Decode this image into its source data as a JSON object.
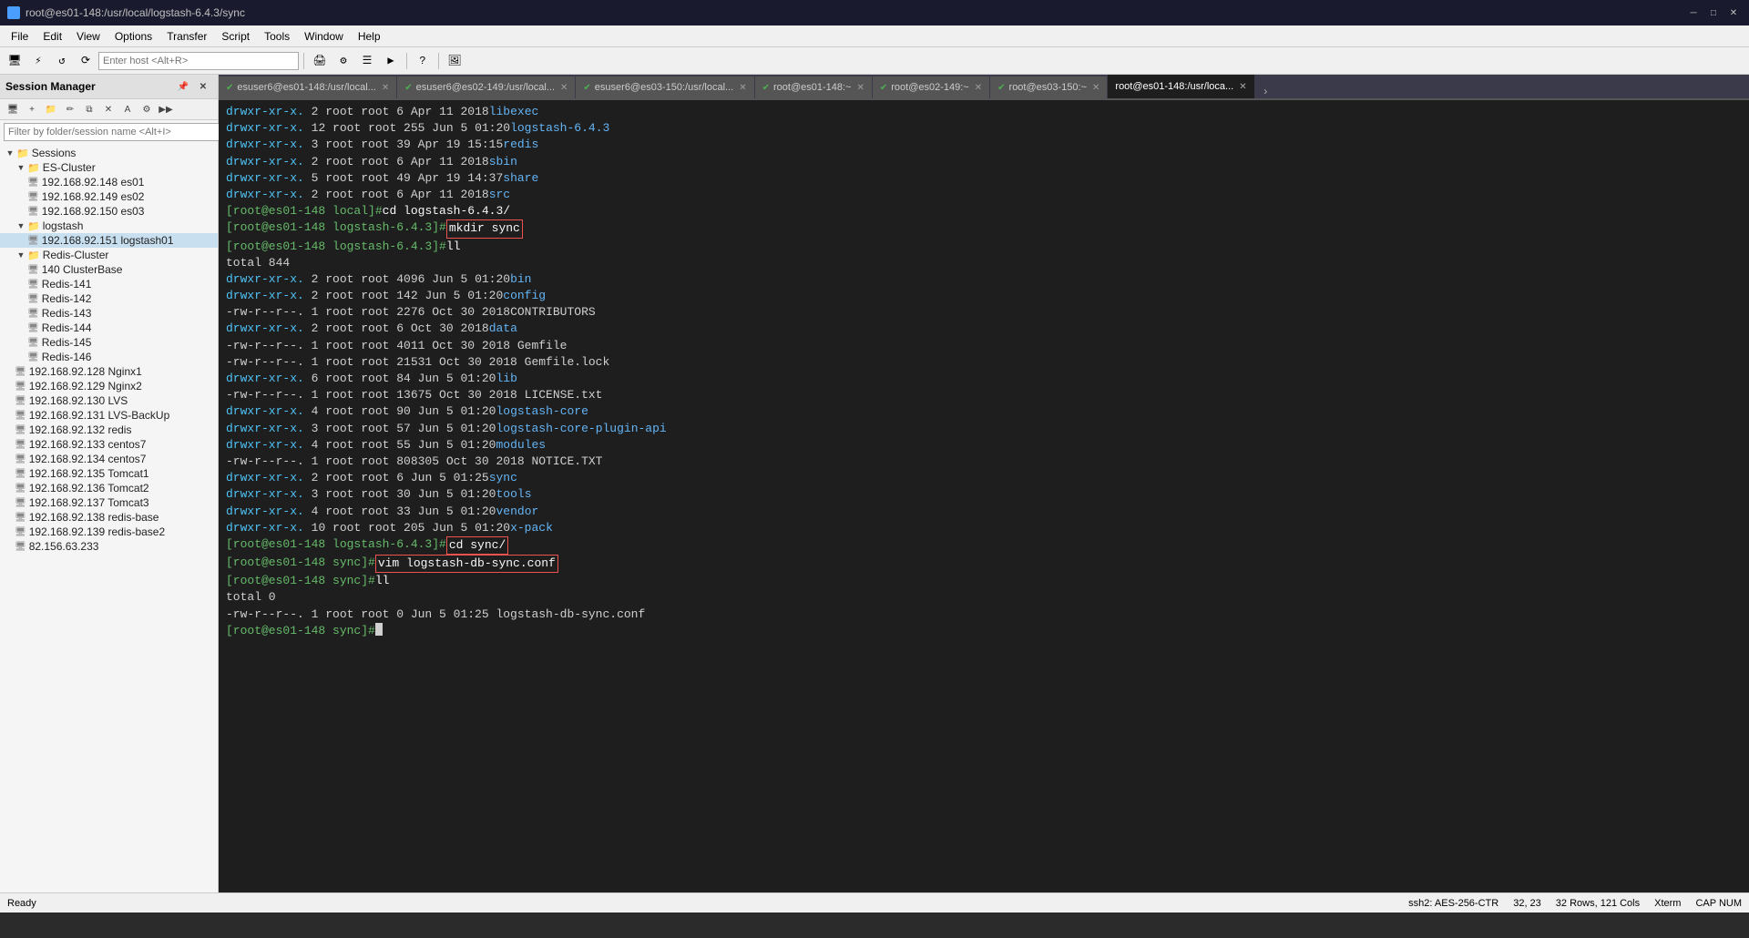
{
  "titlebar": {
    "title": "root@es01-148:/usr/local/logstash-6.4.3/sync",
    "min": "─",
    "max": "□",
    "close": "✕"
  },
  "menubar": {
    "items": [
      "File",
      "Edit",
      "View",
      "Options",
      "Transfer",
      "Script",
      "Tools",
      "Window",
      "Help"
    ]
  },
  "toolbar": {
    "host_placeholder": "Enter host <Alt+R>",
    "host_value": ""
  },
  "session_manager": {
    "title": "Session Manager",
    "filter_placeholder": "Filter by folder/session name <Alt+I>",
    "sessions_label": "Sessions",
    "groups": [
      {
        "name": "ES-Cluster",
        "expanded": true,
        "items": [
          "192.168.92.148 es01",
          "192.168.92.149 es02",
          "192.168.92.150 es03"
        ]
      },
      {
        "name": "logstash",
        "expanded": true,
        "items": [
          "192.168.92.151 logstash01"
        ]
      },
      {
        "name": "Redis-Cluster",
        "expanded": true,
        "items": [
          "140 ClusterBase",
          "Redis-141",
          "Redis-142",
          "Redis-143",
          "Redis-144",
          "Redis-145",
          "Redis-146"
        ]
      }
    ],
    "standalone": [
      "192.168.92.128 Nginx1",
      "192.168.92.129 Nginx2",
      "192.168.92.130 LVS",
      "192.168.92.131 LVS-BackUp",
      "192.168.92.132 redis",
      "192.168.92.133 centos7",
      "192.168.92.134 centos7",
      "192.168.92.135 Tomcat1",
      "192.168.92.136 Tomcat2",
      "192.168.92.137 Tomcat3",
      "192.168.92.138 redis-base",
      "192.168.92.139 redis-base2",
      "82.156.63.233"
    ]
  },
  "tabs": [
    {
      "label": "esuser6@es01-148:/usr/local...",
      "active": false,
      "check": true
    },
    {
      "label": "esuser6@es02-149:/usr/local...",
      "active": false,
      "check": true
    },
    {
      "label": "esuser6@es03-150:/usr/local...",
      "active": false,
      "check": true
    },
    {
      "label": "root@es01-148:~",
      "active": false,
      "check": true
    },
    {
      "label": "root@es02-149:~",
      "active": false,
      "check": true
    },
    {
      "label": "root@es03-150:~",
      "active": false,
      "check": true
    },
    {
      "label": "root@es01-148:/usr/loca...",
      "active": true,
      "check": false
    }
  ],
  "terminal": {
    "lines": [
      {
        "type": "ls",
        "perm": "drwxr-xr-x.",
        "links": "2",
        "user": "root",
        "group": "root",
        "size": "6",
        "date": "Apr 11  2018",
        "name": "libexec"
      },
      {
        "type": "ls",
        "perm": "drwxr-xr-x.",
        "links": "12",
        "user": "root",
        "group": "root",
        "size": "255",
        "date": "Jun  5 01:20",
        "name": "logstash-6.4.3"
      },
      {
        "type": "ls",
        "perm": "drwxr-xr-x.",
        "links": "3",
        "user": "root",
        "group": "root",
        "size": "39",
        "date": "Apr 19 15:15",
        "name": "redis"
      },
      {
        "type": "ls",
        "perm": "drwxr-xr-x.",
        "links": "2",
        "user": "root",
        "group": "root",
        "size": "6",
        "date": "Apr 11  2018",
        "name": "sbin"
      },
      {
        "type": "ls",
        "perm": "drwxr-xr-x.",
        "links": "5",
        "user": "root",
        "group": "root",
        "size": "49",
        "date": "Apr 19 14:37",
        "name": "share"
      },
      {
        "type": "ls",
        "perm": "drwxr-xr-x.",
        "links": "2",
        "user": "root",
        "group": "root",
        "size": "6",
        "date": "Apr 11  2018",
        "name": "src"
      },
      {
        "type": "prompt",
        "user": "root",
        "host": "es01-148",
        "dir": "local",
        "cmd": "cd logstash-6.4.3/"
      },
      {
        "type": "prompt_hl",
        "user": "root",
        "host": "es01-148",
        "dir": "logstash-6.4.3",
        "cmd": "mkdir sync"
      },
      {
        "type": "prompt",
        "user": "root",
        "host": "es01-148",
        "dir": "logstash-6.4.3",
        "cmd": "ll"
      },
      {
        "type": "total",
        "value": "total 844"
      },
      {
        "type": "ls",
        "perm": "drwxr-xr-x.",
        "links": "2",
        "user": "root",
        "group": "root",
        "size": "4096",
        "date": "Jun  5 01:20",
        "name": "bin"
      },
      {
        "type": "ls",
        "perm": "drwxr-xr-x.",
        "links": "2",
        "user": "root",
        "group": "root",
        "size": "142",
        "date": "Jun  5 01:20",
        "name": "config"
      },
      {
        "type": "ls",
        "perm": "-rw-r--r--.",
        "links": "1",
        "user": "root",
        "group": "root",
        "size": "2276",
        "date": "Oct 30  2018",
        "name": "CONTRIBUTORS"
      },
      {
        "type": "ls",
        "perm": "drwxr-xr-x.",
        "links": "2",
        "user": "root",
        "group": "root",
        "size": "6",
        "date": "Oct 30  2018",
        "name": "data"
      },
      {
        "type": "ls",
        "perm": "-rw-r--r--.",
        "links": "1",
        "user": "root",
        "group": "root",
        "size": "4011",
        "date": "Oct 30  2018",
        "name": "Gemfile"
      },
      {
        "type": "ls",
        "perm": "-rw-r--r--.",
        "links": "1",
        "user": "root",
        "group": "root",
        "size": "21531",
        "date": "Oct 30  2018",
        "name": "Gemfile.lock"
      },
      {
        "type": "ls",
        "perm": "drwxr-xr-x.",
        "links": "6",
        "user": "root",
        "group": "root",
        "size": "84",
        "date": "Jun  5 01:20",
        "name": "lib"
      },
      {
        "type": "ls",
        "perm": "-rw-r--r--.",
        "links": "1",
        "user": "root",
        "group": "root",
        "size": "13675",
        "date": "Oct 30  2018",
        "name": "LICENSE.txt"
      },
      {
        "type": "ls",
        "perm": "drwxr-xr-x.",
        "links": "4",
        "user": "root",
        "group": "root",
        "size": "90",
        "date": "Jun  5 01:20",
        "name": "logstash-core"
      },
      {
        "type": "ls",
        "perm": "drwxr-xr-x.",
        "links": "3",
        "user": "root",
        "group": "root",
        "size": "57",
        "date": "Jun  5 01:20",
        "name": "logstash-core-plugin-api"
      },
      {
        "type": "ls",
        "perm": "drwxr-xr-x.",
        "links": "4",
        "user": "root",
        "group": "root",
        "size": "55",
        "date": "Jun  5 01:20",
        "name": "modules"
      },
      {
        "type": "ls",
        "perm": "-rw-r--r--.",
        "links": "1",
        "user": "root",
        "group": "root",
        "size": "808305",
        "date": "Oct 30  2018",
        "name": "NOTICE.TXT"
      },
      {
        "type": "ls",
        "perm": "drwxr-xr-x.",
        "links": "2",
        "user": "root",
        "group": "root",
        "size": "6",
        "date": "Jun  5 01:25",
        "name": "sync"
      },
      {
        "type": "ls",
        "perm": "drwxr-xr-x.",
        "links": "3",
        "user": "root",
        "group": "root",
        "size": "30",
        "date": "Jun  5 01:20",
        "name": "tools"
      },
      {
        "type": "ls",
        "perm": "drwxr-xr-x.",
        "links": "4",
        "user": "root",
        "group": "root",
        "size": "33",
        "date": "Jun  5 01:20",
        "name": "vendor"
      },
      {
        "type": "ls",
        "perm": "drwxr-xr-x.",
        "links": "10",
        "user": "root",
        "group": "root",
        "size": "205",
        "date": "Jun  5 01:20",
        "name": "x-pack"
      },
      {
        "type": "prompt_hl2",
        "user": "root",
        "host": "es01-148",
        "dir": "logstash-6.4.3",
        "cmd": "cd sync/"
      },
      {
        "type": "prompt_hl3",
        "user": "root",
        "host": "es01-148",
        "dir": "sync",
        "cmd": "vim logstash-db-sync.conf"
      },
      {
        "type": "prompt",
        "user": "root",
        "host": "es01-148",
        "dir": "sync",
        "cmd": "ll"
      },
      {
        "type": "total",
        "value": "total 0"
      },
      {
        "type": "ls",
        "perm": "-rw-r--r--.",
        "links": "1",
        "user": "root",
        "group": "root",
        "size": "0",
        "date": "Jun  5 01:25",
        "name": "logstash-db-sync.conf"
      },
      {
        "type": "cursor_prompt",
        "user": "root",
        "host": "es01-148",
        "dir": "sync"
      }
    ]
  },
  "statusbar": {
    "ready": "Ready",
    "ssh": "ssh2: AES-256-CTR",
    "pos": "32, 23",
    "rows_cols": "32 Rows, 121 Cols",
    "xterm": "Xterm",
    "cap_num": "CAP NUM"
  }
}
